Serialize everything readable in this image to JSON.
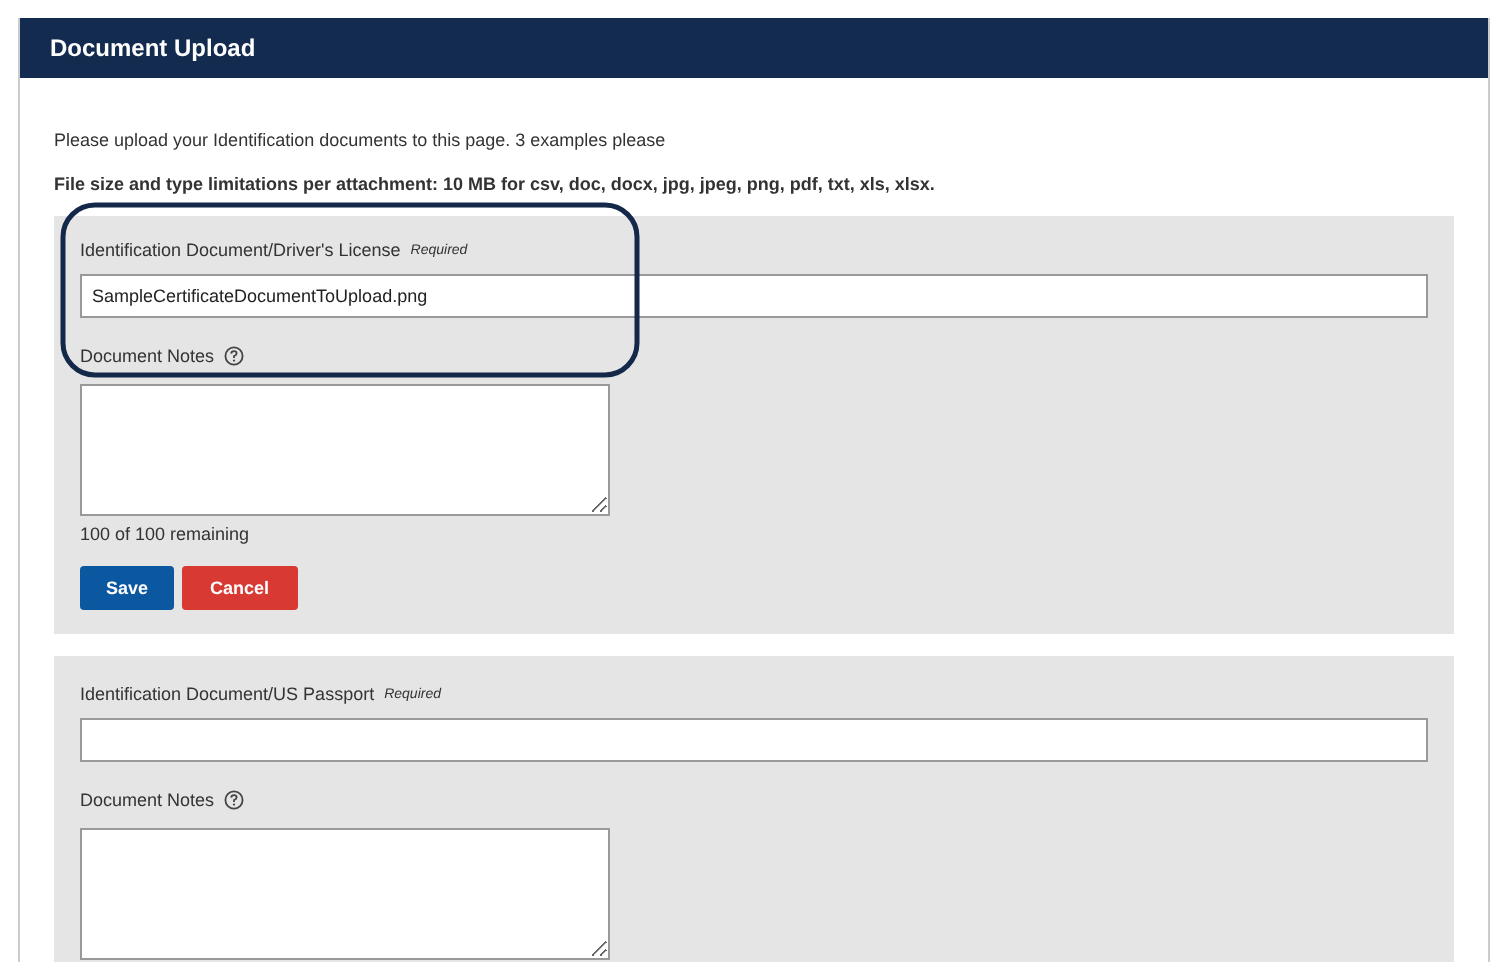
{
  "header": {
    "title": "Document Upload"
  },
  "intro": "Please upload your Identification documents to this page. 3 examples please",
  "limits": "File size and type limitations per attachment: 10 MB for csv, doc, docx, jpg, jpeg, png, pdf, txt, xls, xlsx.",
  "sections": [
    {
      "label": "Identification Document/Driver's License",
      "required": "Required",
      "value": "SampleCertificateDocumentToUpload.png",
      "circled": true,
      "notes_label": "Document Notes",
      "remaining": "100 of 100 remaining",
      "buttons": [
        {
          "label": "Save",
          "kind": "primary"
        },
        {
          "label": "Cancel",
          "kind": "danger"
        }
      ]
    },
    {
      "label": "Identification Document/US Passport",
      "required": "Required",
      "circled": false,
      "notes_label": "Document Notes"
    }
  ]
}
